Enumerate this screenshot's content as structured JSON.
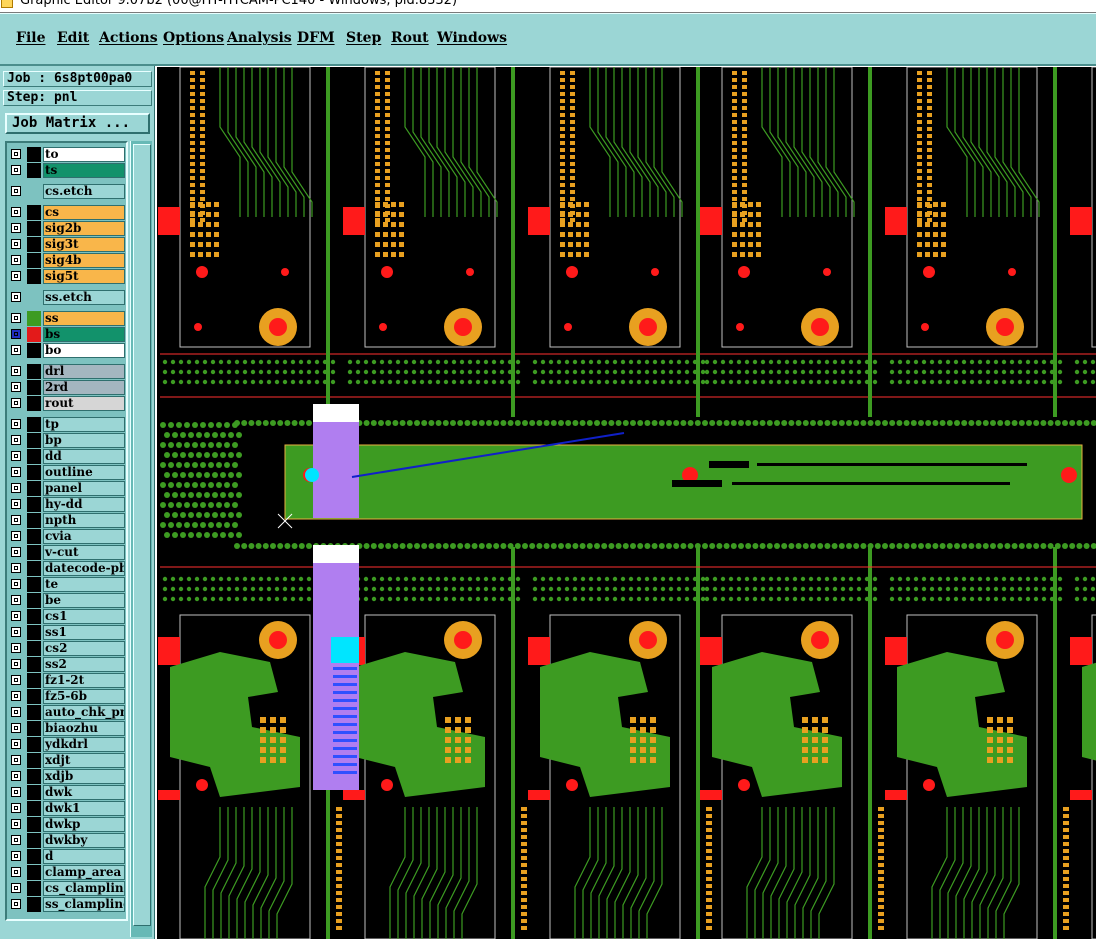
{
  "window": {
    "title": "Graphic Editor 9.07b2 (00@HT-HTCAM-PC140 - Windows, pid.8332)"
  },
  "menu": [
    {
      "label": "File"
    },
    {
      "label": "Edit"
    },
    {
      "label": "Actions"
    },
    {
      "label": "Options"
    },
    {
      "label": "Analysis"
    },
    {
      "label": "DFM"
    },
    {
      "label": "Step"
    },
    {
      "label": "Rout"
    },
    {
      "label": "Windows"
    }
  ],
  "job": {
    "text": "Job : 6s8pt00pa0"
  },
  "step": {
    "text": "Step: pnl"
  },
  "job_matrix_label": "Job Matrix ...",
  "layers": [
    {
      "name": "to",
      "bg": "#ffffff",
      "swatch": "#000000"
    },
    {
      "name": "ts",
      "bg": "#12926b",
      "swatch": "#000000"
    },
    {
      "name": "cs.etch",
      "bg": "#9bd6d5",
      "swatch": ""
    },
    {
      "name": "cs",
      "bg": "#f9b64a",
      "swatch": "#000000"
    },
    {
      "name": "sig2b",
      "bg": "#f9b64a",
      "swatch": "#000000"
    },
    {
      "name": "sig3t",
      "bg": "#f9b64a",
      "swatch": "#000000"
    },
    {
      "name": "sig4b",
      "bg": "#f9b64a",
      "swatch": "#000000"
    },
    {
      "name": "sig5t",
      "bg": "#f9b64a",
      "swatch": "#000000"
    },
    {
      "name": "ss.etch",
      "bg": "#9bd6d5",
      "swatch": ""
    },
    {
      "name": "ss",
      "bg": "#f9b64a",
      "swatch": "#3d9b22"
    },
    {
      "name": "bs",
      "bg": "#12926b",
      "swatch": "#e31a1a",
      "selected": true
    },
    {
      "name": "bo",
      "bg": "#ffffff",
      "swatch": "#000000"
    },
    {
      "name": "drl",
      "bg": "#a4b6c0",
      "swatch": "#000000"
    },
    {
      "name": "2rd",
      "bg": "#a4b6c0",
      "swatch": "#000000"
    },
    {
      "name": "rout",
      "bg": "#d6d6d6",
      "swatch": "#000000"
    },
    {
      "name": "tp",
      "bg": "#9bd6d5",
      "swatch": "#000000"
    },
    {
      "name": "bp",
      "bg": "#9bd6d5",
      "swatch": "#000000"
    },
    {
      "name": "dd",
      "bg": "#9bd6d5",
      "swatch": "#000000"
    },
    {
      "name": "outline",
      "bg": "#9bd6d5",
      "swatch": "#000000"
    },
    {
      "name": "panel",
      "bg": "#9bd6d5",
      "swatch": "#000000"
    },
    {
      "name": "hy-dd",
      "bg": "#9bd6d5",
      "swatch": "#000000"
    },
    {
      "name": "npth",
      "bg": "#9bd6d5",
      "swatch": "#000000"
    },
    {
      "name": "cvia",
      "bg": "#9bd6d5",
      "swatch": "#000000"
    },
    {
      "name": "v-cut",
      "bg": "#9bd6d5",
      "swatch": "#000000"
    },
    {
      "name": "datecode-pbe",
      "bg": "#9bd6d5",
      "swatch": "#000000"
    },
    {
      "name": "te",
      "bg": "#9bd6d5",
      "swatch": "#000000"
    },
    {
      "name": "be",
      "bg": "#9bd6d5",
      "swatch": "#000000"
    },
    {
      "name": "cs1",
      "bg": "#9bd6d5",
      "swatch": "#000000"
    },
    {
      "name": "ss1",
      "bg": "#9bd6d5",
      "swatch": "#000000"
    },
    {
      "name": "cs2",
      "bg": "#9bd6d5",
      "swatch": "#000000"
    },
    {
      "name": "ss2",
      "bg": "#9bd6d5",
      "swatch": "#000000"
    },
    {
      "name": "fz1-2t",
      "bg": "#9bd6d5",
      "swatch": "#000000"
    },
    {
      "name": "fz5-6b",
      "bg": "#9bd6d5",
      "swatch": "#000000"
    },
    {
      "name": "auto_chk_pnl",
      "bg": "#9bd6d5",
      "swatch": "#000000"
    },
    {
      "name": "biaozhu",
      "bg": "#9bd6d5",
      "swatch": "#000000"
    },
    {
      "name": "ydkdrl",
      "bg": "#9bd6d5",
      "swatch": "#000000"
    },
    {
      "name": "xdjt",
      "bg": "#9bd6d5",
      "swatch": "#000000"
    },
    {
      "name": "xdjb",
      "bg": "#9bd6d5",
      "swatch": "#000000"
    },
    {
      "name": "dwk",
      "bg": "#9bd6d5",
      "swatch": "#000000"
    },
    {
      "name": "dwk1",
      "bg": "#9bd6d5",
      "swatch": "#000000"
    },
    {
      "name": "dwkp",
      "bg": "#9bd6d5",
      "swatch": "#000000"
    },
    {
      "name": "dwkby",
      "bg": "#9bd6d5",
      "swatch": "#000000"
    },
    {
      "name": "d",
      "bg": "#9bd6d5",
      "swatch": "#000000"
    },
    {
      "name": "clamp_area",
      "bg": "#9bd6d5",
      "swatch": "#000000"
    },
    {
      "name": "cs_clampline",
      "bg": "#9bd6d5",
      "swatch": "#000000"
    },
    {
      "name": "ss_clampline",
      "bg": "#9bd6d5",
      "swatch": "#000000"
    }
  ],
  "colors": {
    "copper_green": "#3d9b22",
    "pad_orange": "#e8a020",
    "pad_red": "#ff1a1a",
    "highlight_purple": "#b07ef0",
    "cyan": "#00e5ff",
    "measure_blue": "#1020c8"
  }
}
